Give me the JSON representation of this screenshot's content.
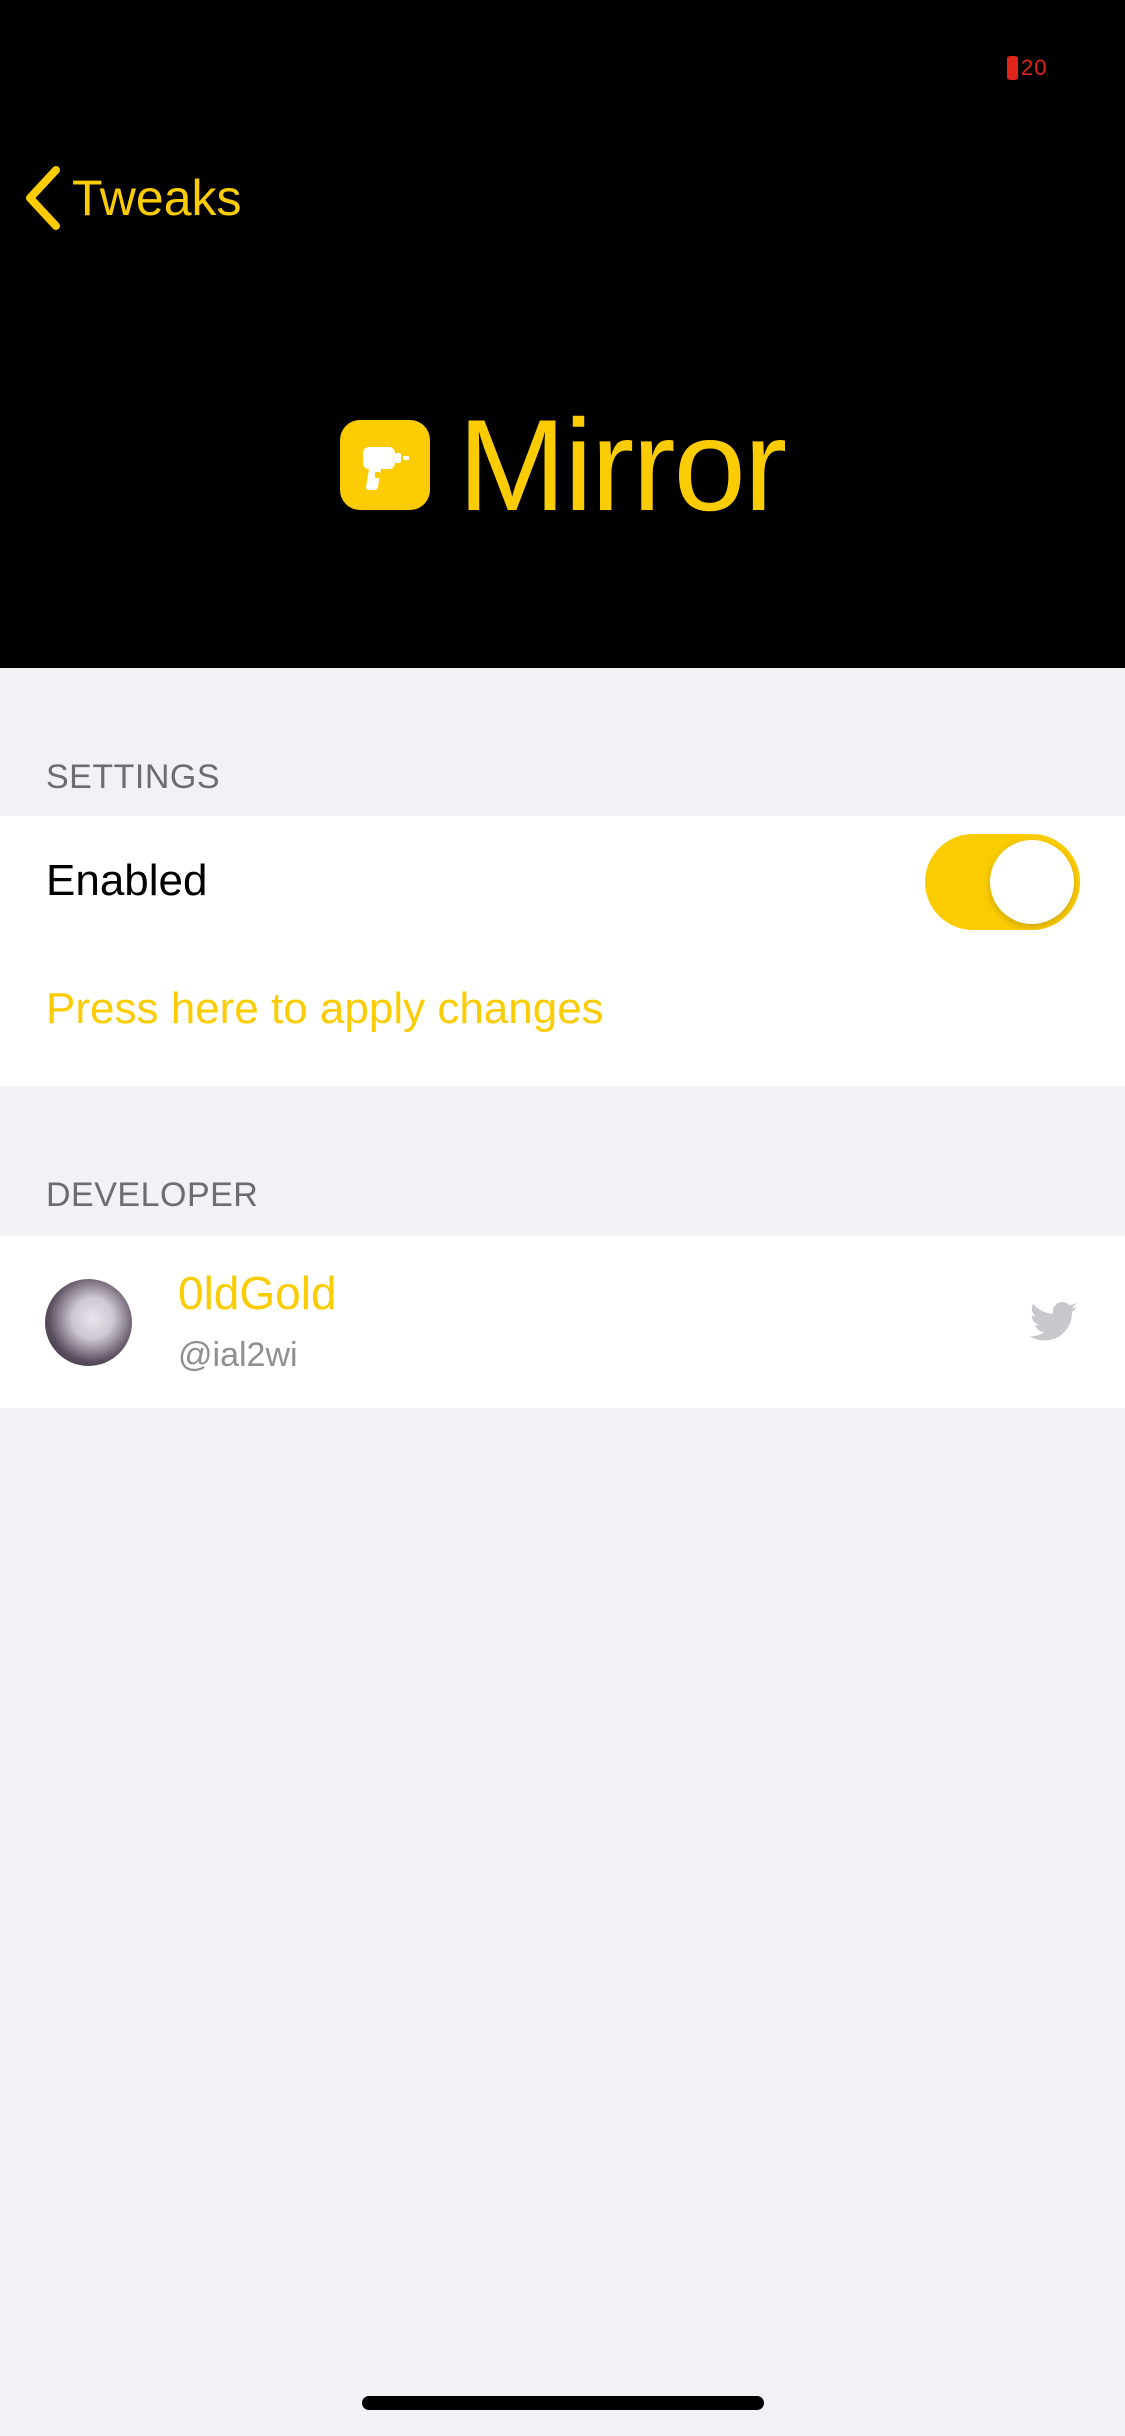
{
  "status_bar": {
    "battery_level": "20",
    "battery_color": "#e0241b"
  },
  "nav": {
    "back_label": "Tweaks",
    "back_icon": "chevron-left-icon"
  },
  "header": {
    "title": "Mirror",
    "app_icon": "drill-icon",
    "background": "#000000"
  },
  "settings_section": {
    "header": "SETTINGS",
    "enabled_label": "Enabled",
    "enabled_value": true,
    "apply_label": "Press here to apply changes"
  },
  "developer_section": {
    "header": "DEVELOPER",
    "name": "0ldGold",
    "handle": "@ial2wi",
    "link_icon": "twitter-icon"
  },
  "colors": {
    "accent": "#fbcc02",
    "grouped_background": "#f1f1f6",
    "section_header": "#6c6c72",
    "secondary_text": "#8e8e93"
  }
}
